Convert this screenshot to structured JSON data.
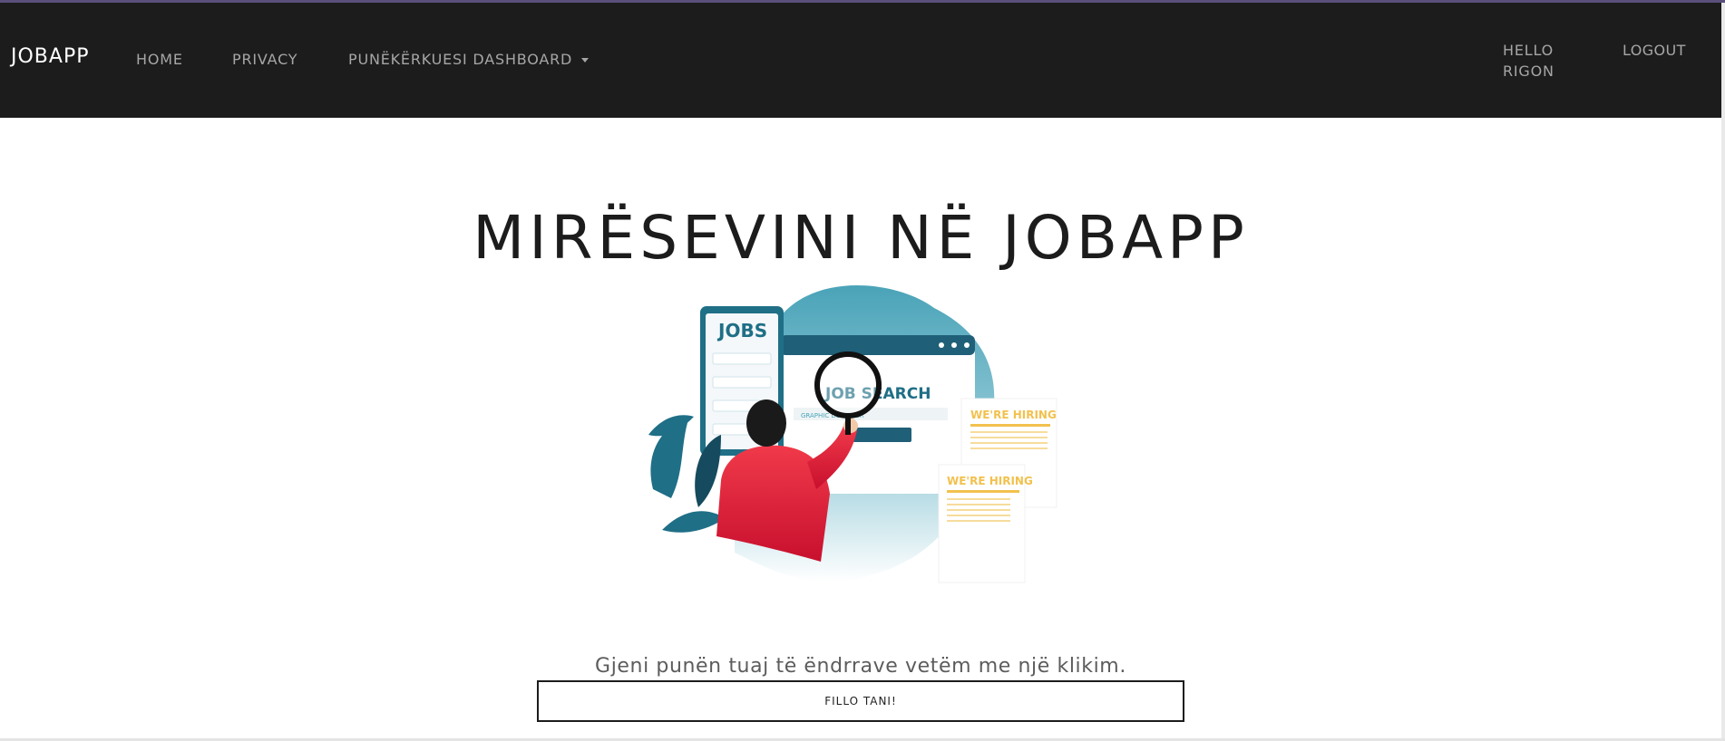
{
  "navbar": {
    "brand": "JOBAPP",
    "links": [
      {
        "label": "HOME"
      },
      {
        "label": "PRIVACY"
      },
      {
        "label": "PUNËKËRKUESI DASHBOARD"
      }
    ],
    "greeting_line1": "HELLO",
    "greeting_line2": "RIGON",
    "logout_label": "LOGOUT"
  },
  "hero": {
    "title": "MIRËSEVINI NË JOBAPP",
    "tagline": "Gjeni punën tuaj të ëndrrave vetëm me një klikim.",
    "cta_label": "FILLO TANI!"
  },
  "illustration": {
    "jobs_label": "JOBS",
    "search_label": "JOB SEARCH",
    "hiring_label_1": "WE'RE HIRING",
    "hiring_label_2": "WE'RE HIRING",
    "search_hint": "GRAPHIC DESIGNER"
  },
  "colors": {
    "navbar_bg": "#1c1c1c",
    "nav_text": "#a6a6a6",
    "teal": "#1f6f86",
    "person_shirt": "#e0283e",
    "hiring_yellow": "#f2c14e"
  }
}
